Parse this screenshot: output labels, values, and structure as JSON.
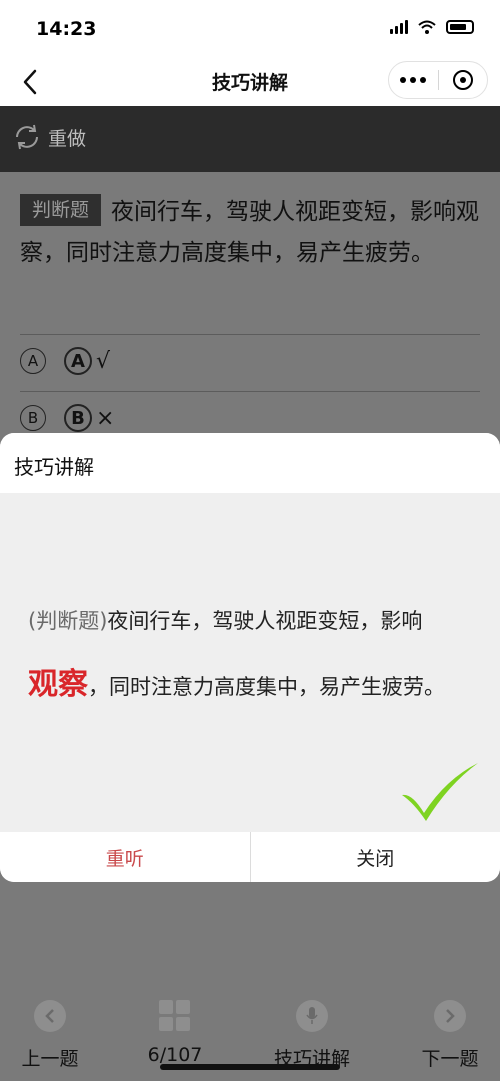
{
  "status_bar": {
    "time": "14:23"
  },
  "nav": {
    "title": "技巧讲解"
  },
  "toolbar": {
    "redo_label": "重做"
  },
  "question": {
    "type_tag": "判断题",
    "text": "夜间行车，驾驶人视距变短，影响观察，同时注意力高度集中，易产生疲劳。",
    "options": [
      {
        "letter": "A",
        "answer_letter": "A",
        "mark": "√"
      },
      {
        "letter": "B",
        "answer_letter": "B",
        "mark": "×"
      }
    ]
  },
  "modal": {
    "title": "技巧讲解",
    "explain_tag": "(判断题)",
    "line1_text": "夜间行车，驾驶人视距变短，影响",
    "highlight": "观察",
    "line2_text": "，同时注意力高度集中，易产生疲劳。",
    "replay_label": "重听",
    "close_label": "关闭",
    "accent_color": "#d9262a",
    "check_color": "#7ed321"
  },
  "bottom_bar": {
    "prev_label": "上一题",
    "progress": "6/107",
    "tips_label": "技巧讲解",
    "next_label": "下一题"
  }
}
